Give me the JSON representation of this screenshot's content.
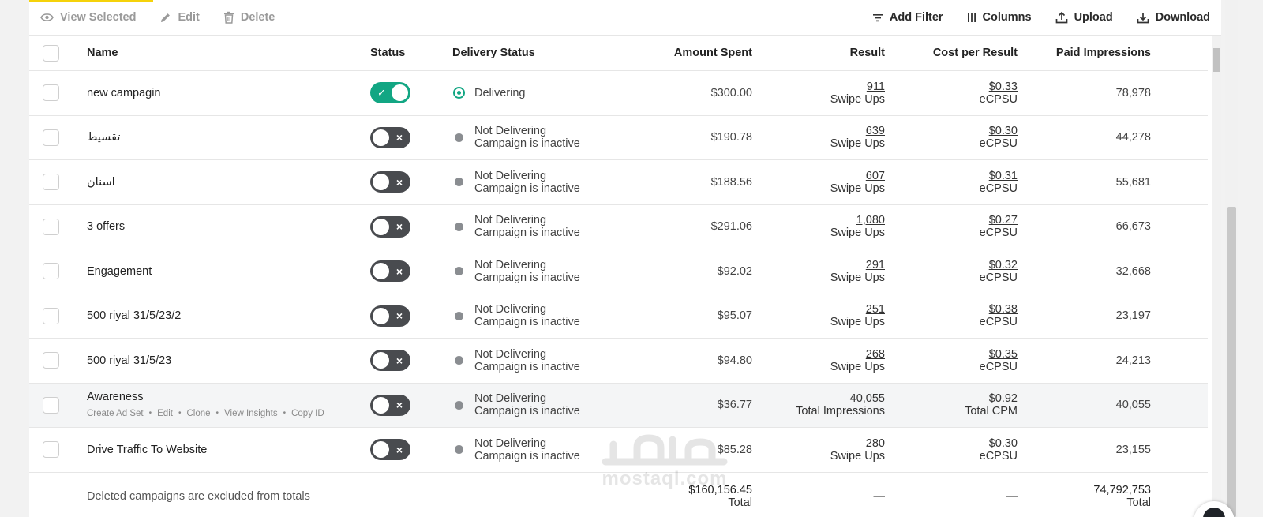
{
  "toolbar": {
    "view_selected": "View Selected",
    "edit": "Edit",
    "delete": "Delete",
    "add_filter": "Add Filter",
    "columns": "Columns",
    "upload": "Upload",
    "download": "Download"
  },
  "colors": {
    "accent_yellow": "#f5d20a",
    "toggle_on": "#12a683",
    "toggle_off": "#494b4f"
  },
  "table": {
    "headers": {
      "name": "Name",
      "status": "Status",
      "delivery_status": "Delivery Status",
      "amount_spent": "Amount Spent",
      "result": "Result",
      "cost_per_result": "Cost per Result",
      "paid_impressions": "Paid Impressions"
    },
    "rows": [
      {
        "name": "new campagin",
        "status_on": true,
        "delivery": "Delivering",
        "delivery_sub": "",
        "amount": "$300.00",
        "result": "911",
        "result_sub": "Swipe Ups",
        "cpr": "$0.33",
        "cpr_sub": "eCPSU",
        "impressions": "78,978"
      },
      {
        "name": "تقسيط",
        "status_on": false,
        "delivery": "Not Delivering",
        "delivery_sub": "Campaign is inactive",
        "amount": "$190.78",
        "result": "639",
        "result_sub": "Swipe Ups",
        "cpr": "$0.30",
        "cpr_sub": "eCPSU",
        "impressions": "44,278"
      },
      {
        "name": "اسنان",
        "status_on": false,
        "delivery": "Not Delivering",
        "delivery_sub": "Campaign is inactive",
        "amount": "$188.56",
        "result": "607",
        "result_sub": "Swipe Ups",
        "cpr": "$0.31",
        "cpr_sub": "eCPSU",
        "impressions": "55,681"
      },
      {
        "name": "3 offers",
        "status_on": false,
        "delivery": "Not Delivering",
        "delivery_sub": "Campaign is inactive",
        "amount": "$291.06",
        "result": "1,080",
        "result_sub": "Swipe Ups",
        "cpr": "$0.27",
        "cpr_sub": "eCPSU",
        "impressions": "66,673"
      },
      {
        "name": "Engagement",
        "status_on": false,
        "delivery": "Not Delivering",
        "delivery_sub": "Campaign is inactive",
        "amount": "$92.02",
        "result": "291",
        "result_sub": "Swipe Ups",
        "cpr": "$0.32",
        "cpr_sub": "eCPSU",
        "impressions": "32,668"
      },
      {
        "name": "500 riyal 31/5/23/2",
        "status_on": false,
        "delivery": "Not Delivering",
        "delivery_sub": "Campaign is inactive",
        "amount": "$95.07",
        "result": "251",
        "result_sub": "Swipe Ups",
        "cpr": "$0.38",
        "cpr_sub": "eCPSU",
        "impressions": "23,197"
      },
      {
        "name": "500 riyal 31/5/23",
        "status_on": false,
        "delivery": "Not Delivering",
        "delivery_sub": "Campaign is inactive",
        "amount": "$94.80",
        "result": "268",
        "result_sub": "Swipe Ups",
        "cpr": "$0.35",
        "cpr_sub": "eCPSU",
        "impressions": "24,213"
      },
      {
        "name": "Awareness",
        "status_on": false,
        "delivery": "Not Delivering",
        "delivery_sub": "Campaign is inactive",
        "amount": "$36.77",
        "result": "40,055",
        "result_sub": "Total Impressions",
        "cpr": "$0.92",
        "cpr_sub": "Total CPM",
        "impressions": "40,055"
      },
      {
        "name": "Drive Traffic To Website",
        "status_on": false,
        "delivery": "Not Delivering",
        "delivery_sub": "Campaign is inactive",
        "amount": "$85.28",
        "result": "280",
        "result_sub": "Swipe Ups",
        "cpr": "$0.30",
        "cpr_sub": "eCPSU",
        "impressions": "23,155"
      }
    ],
    "row_actions": [
      "Create Ad Set",
      "Edit",
      "Clone",
      "View Insights",
      "Copy ID"
    ],
    "action_separator": "•",
    "totals": {
      "note": "Deleted campaigns are excluded from totals",
      "amount": "$160,156.45",
      "amount_sub": "Total",
      "result": "—",
      "cpr": "—",
      "impressions": "74,792,753",
      "impressions_sub": "Total"
    }
  },
  "watermark": {
    "text": "mostaql.com"
  }
}
